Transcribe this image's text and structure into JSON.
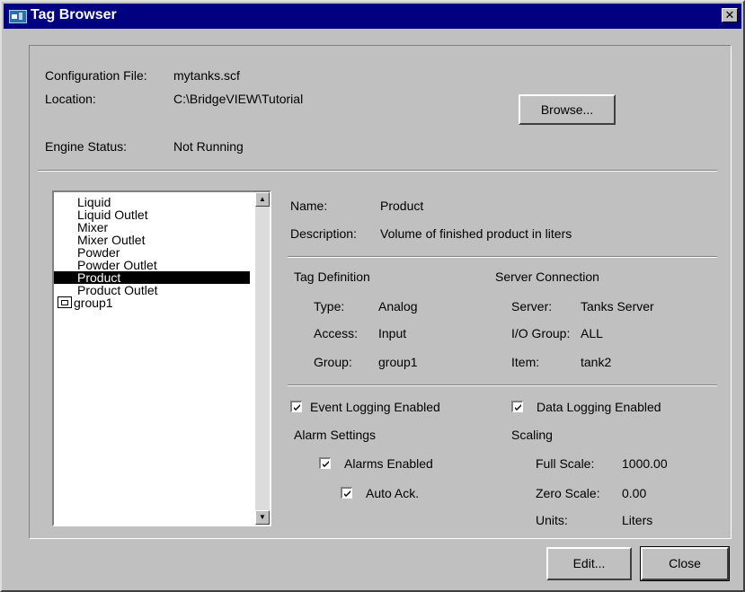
{
  "window": {
    "title": "Tag Browser",
    "close_glyph": "✕"
  },
  "config": {
    "file_label": "Configuration File:",
    "file_value": "mytanks.scf",
    "location_label": "Location:",
    "location_value": "C:\\BridgeVIEW\\Tutorial",
    "engine_label": "Engine Status:",
    "engine_value": "Not Running",
    "browse_label": "Browse..."
  },
  "tag_list": {
    "items": [
      "Liquid",
      "Liquid Outlet",
      "Mixer",
      "Mixer Outlet",
      "Powder",
      "Powder Outlet",
      "Product",
      "Product Outlet"
    ],
    "selected": "Product",
    "folder": "group1",
    "folder_icon": "folder-icon"
  },
  "tag": {
    "name_label": "Name:",
    "name_value": "Product",
    "description_label": "Description:",
    "description_value": "Volume of finished product in liters"
  },
  "definition": {
    "heading": "Tag Definition",
    "type_label": "Type:",
    "type_value": "Analog",
    "access_label": "Access:",
    "access_value": "Input",
    "group_label": "Group:",
    "group_value": "group1"
  },
  "server": {
    "heading": "Server Connection",
    "server_label": "Server:",
    "server_value": "Tanks Server",
    "io_group_label": "I/O Group:",
    "io_group_value": "ALL",
    "item_label": "Item:",
    "item_value": "tank2"
  },
  "logging": {
    "event_label": "Event Logging Enabled",
    "event_checked": true,
    "data_label": "Data Logging Enabled",
    "data_checked": true
  },
  "alarms": {
    "heading": "Alarm Settings",
    "enabled_label": "Alarms Enabled",
    "enabled_checked": true,
    "auto_ack_label": "Auto Ack.",
    "auto_ack_checked": true
  },
  "scaling": {
    "heading": "Scaling",
    "full_label": "Full Scale:",
    "full_value": "1000.00",
    "zero_label": "Zero Scale:",
    "zero_value": "0.00",
    "units_label": "Units:",
    "units_value": "Liters"
  },
  "buttons": {
    "edit": "Edit...",
    "close": "Close"
  }
}
